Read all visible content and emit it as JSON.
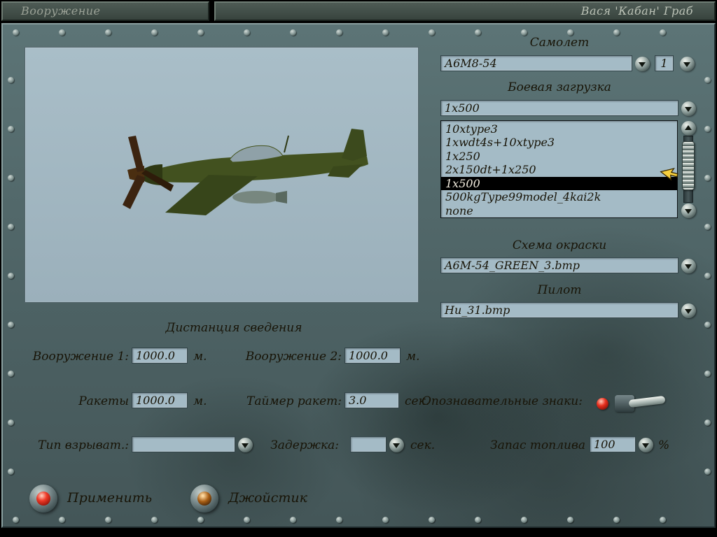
{
  "header": {
    "screen_title": "Вооружение",
    "player_name": "Вася 'Кабан' Граб"
  },
  "aircraft": {
    "label": "Самолет",
    "selected": "А6М8-54",
    "count": "1"
  },
  "loadout": {
    "label": "Боевая загрузка",
    "selected": "1x500",
    "selected_index": 4,
    "options": [
      "10xtype3",
      "1xwdt4s+10xtype3",
      "1x250",
      "2x150dt+1x250",
      "1x500",
      "500kgType99model_4kai2k",
      "none"
    ]
  },
  "paint": {
    "label": "Схема окраски",
    "selected": "A6M-54_GREEN_3.bmp"
  },
  "pilot": {
    "label": "Пилот",
    "selected": "Hu_31.bmp"
  },
  "convergence": {
    "title": "Дистанция сведения"
  },
  "fields": {
    "weapon1": {
      "label": "Вооружение 1:",
      "value": "1000.0",
      "unit": "м."
    },
    "weapon2": {
      "label": "Вооружение 2:",
      "value": "1000.0",
      "unit": "м."
    },
    "rockets": {
      "label": "Ракеты",
      "value": "1000.0",
      "unit": "м."
    },
    "rocket_timer": {
      "label": "Таймер ракет:",
      "value": "3.0",
      "unit": "сек."
    },
    "markings": {
      "label": "Опознавательные знаки:"
    },
    "fuze_type": {
      "label": "Тип взрыват.:",
      "value": ""
    },
    "delay": {
      "label": "Задержка:",
      "value": "",
      "unit": "сек."
    },
    "fuel": {
      "label": "Запас топлива",
      "value": "100",
      "unit": "%"
    }
  },
  "buttons": {
    "apply": "Применить",
    "joystick": "Джойстик"
  },
  "colors": {
    "panel": "#4d6264",
    "field_bg": "#a4bbc6",
    "selected_bg": "#000000",
    "apply_button": "#ef3a28"
  }
}
